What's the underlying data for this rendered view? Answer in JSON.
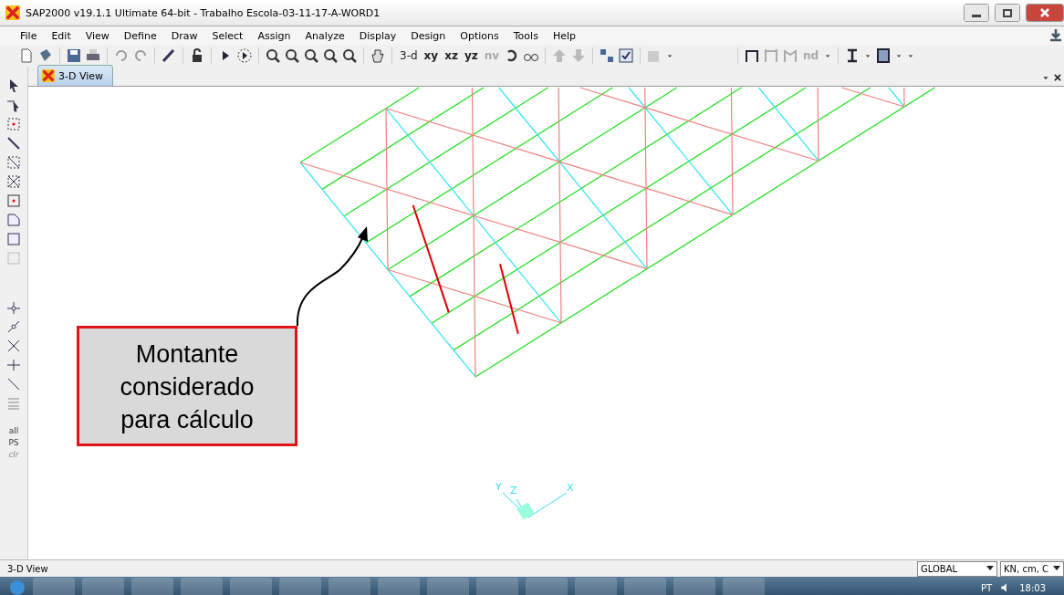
{
  "window": {
    "title": "SAP2000 v19.1.1 Ultimate 64-bit - Trabalho Escola-03-11-17-A-WORD1"
  },
  "menu": [
    "File",
    "Edit",
    "View",
    "Define",
    "Draw",
    "Select",
    "Assign",
    "Analyze",
    "Display",
    "Design",
    "Options",
    "Tools",
    "Help"
  ],
  "toolbar": {
    "view_buttons": [
      {
        "label": "3-d",
        "disabled": false
      },
      {
        "label": "xy",
        "disabled": false
      },
      {
        "label": "xz",
        "disabled": false
      },
      {
        "label": "yz",
        "disabled": false
      },
      {
        "label": "nv",
        "disabled": true
      }
    ],
    "section_button": {
      "label": "nd",
      "disabled": true
    }
  },
  "tabs": [
    {
      "label": "3-D View",
      "selected": true
    }
  ],
  "left_tools": [
    {
      "label": "all",
      "disabled": false
    },
    {
      "label": "PS",
      "disabled": false
    },
    {
      "label": "clr",
      "disabled": true
    }
  ],
  "callout": {
    "text": "Montante considerado para cálculo"
  },
  "axes": [
    "Y",
    "Z",
    "X"
  ],
  "status_bar": {
    "text": "3-D View",
    "coordinate_system": "GLOBAL",
    "units": "KN, cm, C"
  },
  "taskbar": {
    "language": "PT",
    "time": "18:03"
  }
}
